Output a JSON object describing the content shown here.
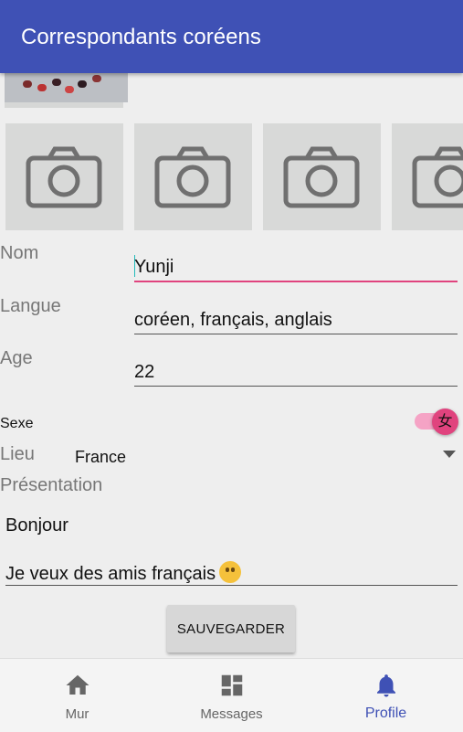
{
  "app_bar": {
    "title": "Correspondants coréens"
  },
  "photos": {
    "placeholder_count": 4,
    "placeholder_icon": "camera-icon"
  },
  "form": {
    "nom": {
      "label": "Nom",
      "value": "Yunji"
    },
    "langue": {
      "label": "Langue",
      "value": "coréen, français, anglais"
    },
    "age": {
      "label": "Age",
      "value": "22"
    },
    "sexe": {
      "label": "Sexe",
      "switch_glyph": "女",
      "switch_on": true
    },
    "lieu": {
      "label": "Lieu",
      "value": "France"
    },
    "presentation": {
      "label": "Présentation",
      "line1": "Bonjour",
      "line2": "Je veux des amis français"
    }
  },
  "save_button": {
    "label": "SAUVEGARDER"
  },
  "bottom_nav": [
    {
      "label": "Mur",
      "icon": "home-icon"
    },
    {
      "label": "Messages",
      "icon": "dashboard-icon"
    },
    {
      "label": "Profile",
      "icon": "bell-icon",
      "active": true
    }
  ],
  "colors": {
    "primary": "#3f51b5",
    "accent": "#e0437e"
  }
}
